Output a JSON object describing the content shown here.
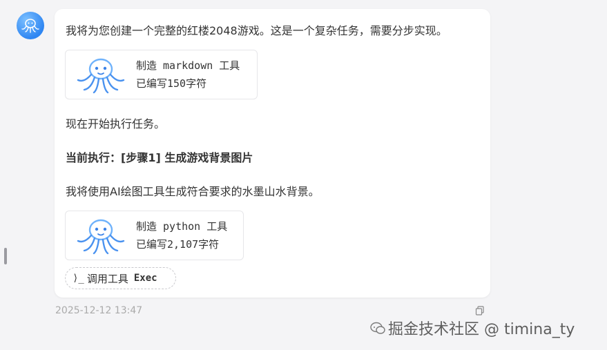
{
  "message": {
    "intro": "我将为您创建一个完整的红楼2048游戏。这是一个复杂任务，需要分步实现。",
    "tool_cards": [
      {
        "title": "制造 markdown 工具",
        "subtitle": "已编写150字符",
        "icon": "octopus-icon"
      },
      {
        "title": "制造 python 工具",
        "subtitle": "已编写2,107字符",
        "icon": "octopus-icon"
      }
    ],
    "start_text": "现在开始执行任务。",
    "step_heading": "当前执行：[步骤1] 生成游戏背景图片",
    "step_desc": "我将使用AI绘图工具生成符合要求的水墨山水背景。",
    "exec_button": {
      "prompt": "⟩_",
      "label": "调用工具",
      "tool": "Exec"
    },
    "timestamp": "2025-12-12 13:47"
  },
  "watermark": "掘金技术社区 @ timina_ty",
  "colors": {
    "accent": "#2f86f2",
    "octopus_light": "#8ec5ff",
    "octopus_dark": "#3a82e8"
  }
}
